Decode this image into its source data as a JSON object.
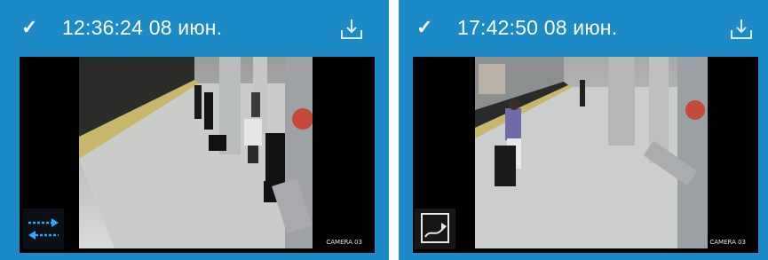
{
  "cards": [
    {
      "timestamp": "12:36:24 08 июн.",
      "icons": {
        "status": "check-icon",
        "download": "download-icon",
        "overlay": "swap-arrows-icon"
      },
      "video_stamp": "CAMERA 03"
    },
    {
      "timestamp": "17:42:50 08 июн.",
      "icons": {
        "status": "check-icon",
        "download": "download-icon",
        "overlay": "path-route-icon"
      },
      "video_stamp": "CAMERA 03"
    }
  ],
  "colors": {
    "header_blue": "#1c8ac6",
    "frame_black": "#000000",
    "overlay_blue": "#2aa9ff"
  }
}
